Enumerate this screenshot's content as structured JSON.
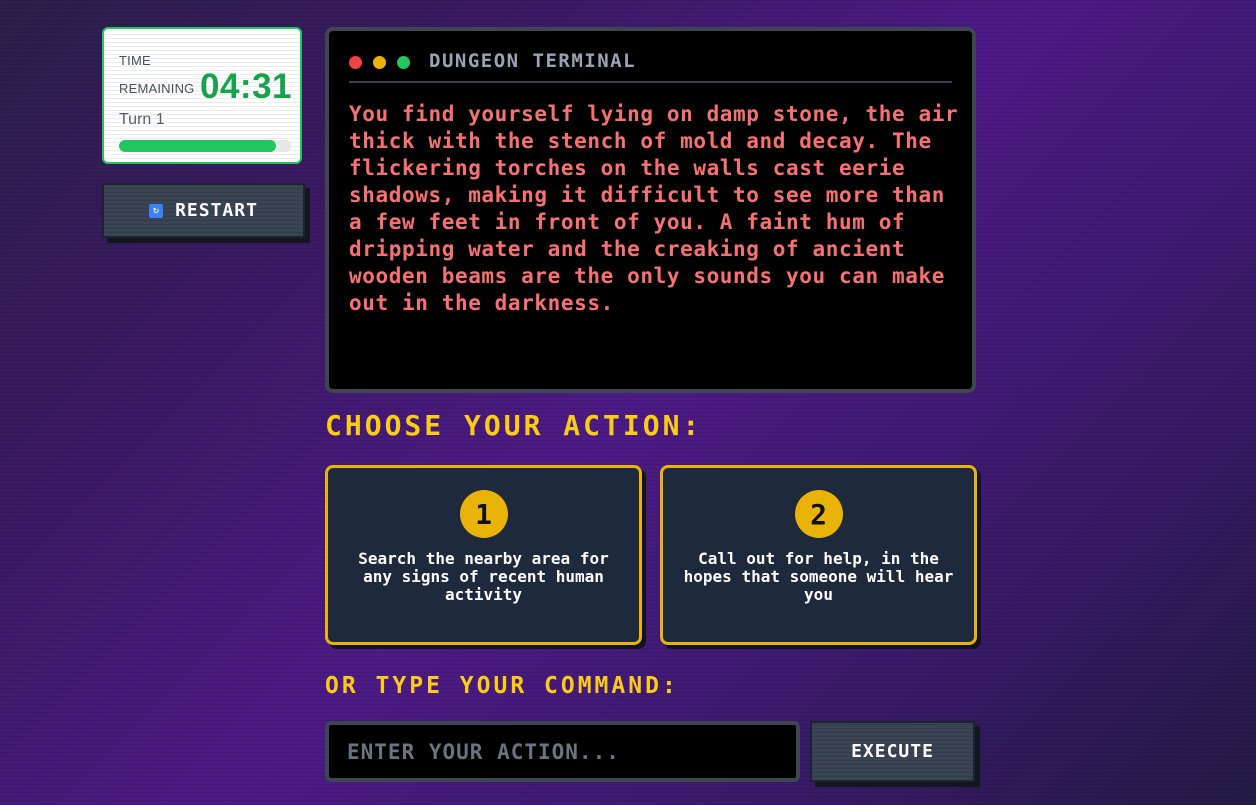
{
  "timer": {
    "label_line1": "TIME",
    "label_line2": "REMAINING",
    "value": "04:31",
    "turn": "Turn 1",
    "progress_percent": 91
  },
  "restart": {
    "icon": "refresh-icon",
    "label": "RESTART"
  },
  "terminal": {
    "title": "DUNGEON TERMINAL",
    "window_dots": [
      "#ef4444",
      "#eab308",
      "#22c55e"
    ],
    "text": "You find yourself lying on damp stone, the air thick with the stench of mold and decay. The flickering torches on the walls cast eerie shadows, making it difficult to see more than a few feet in front of you. A faint hum of dripping water and the creaking of ancient wooden beams are the only sounds you can make out in the darkness."
  },
  "actions": {
    "heading": "CHOOSE YOUR ACTION:",
    "items": [
      {
        "number": "1",
        "text": "Search the nearby area for any signs of recent human activity"
      },
      {
        "number": "2",
        "text": "Call out for help, in the hopes that someone will hear you"
      }
    ]
  },
  "command": {
    "heading": "OR TYPE YOUR COMMAND:",
    "placeholder": "ENTER YOUR ACTION...",
    "value": "",
    "execute_label": "EXECUTE"
  },
  "colors": {
    "accent": "#facc15",
    "terminal_text": "#f87171",
    "timer": "#16a34a"
  }
}
